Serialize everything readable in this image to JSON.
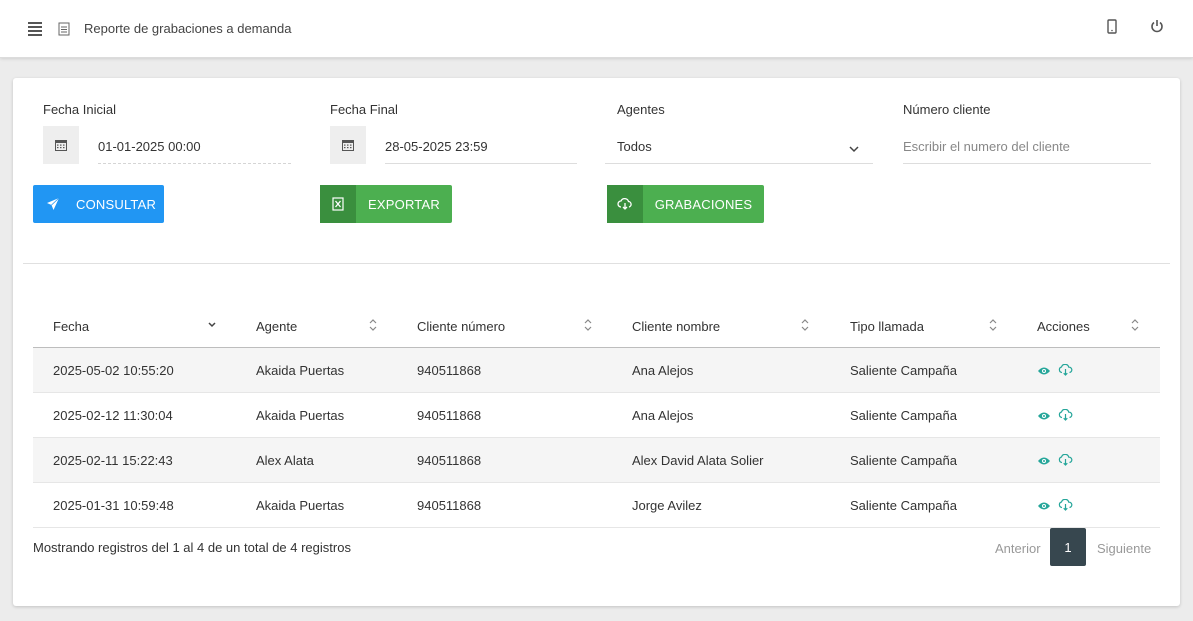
{
  "header": {
    "title": "Reporte de grabaciones a demanda",
    "icons": [
      "menu-icon",
      "document-icon",
      "mobile-icon",
      "power-icon"
    ]
  },
  "filters": {
    "start_label": "Fecha Inicial",
    "start_value": "01-01-2025 00:00",
    "end_label": "Fecha Final",
    "end_value": "28-05-2025 23:59",
    "agents_label": "Agentes",
    "agents_value": "Todos",
    "client_label": "Número cliente",
    "client_placeholder": "Escribir el numero del cliente"
  },
  "buttons": {
    "consultar": "CONSULTAR",
    "exportar": "EXPORTAR",
    "grabaciones": "GRABACIONES"
  },
  "table": {
    "columns": [
      "Fecha",
      "Agente",
      "Cliente número",
      "Cliente nombre",
      "Tipo llamada",
      "Acciones"
    ],
    "rows": [
      [
        "2025-05-02 10:55:20",
        "Akaida Puertas",
        "940511868",
        "Ana Alejos",
        "Saliente Campaña"
      ],
      [
        "2025-02-12 11:30:04",
        "Akaida Puertas",
        "940511868",
        "Ana Alejos",
        "Saliente Campaña"
      ],
      [
        "2025-02-11 15:22:43",
        "Alex Alata",
        "940511868",
        "Alex David Alata Solier",
        "Saliente Campaña"
      ],
      [
        "2025-01-31 10:59:48",
        "Akaida Puertas",
        "940511868",
        "Jorge Avilez",
        "Saliente Campaña"
      ]
    ]
  },
  "footer": {
    "info": "Mostrando registros del 1 al 4 de un total de 4 registros",
    "prev": "Anterior",
    "page": "1",
    "next": "Siguiente"
  },
  "colors": {
    "blue": "#2196f3",
    "green": "#4caf50",
    "teal_icon": "#26a69a",
    "page_active": "#37474f"
  }
}
